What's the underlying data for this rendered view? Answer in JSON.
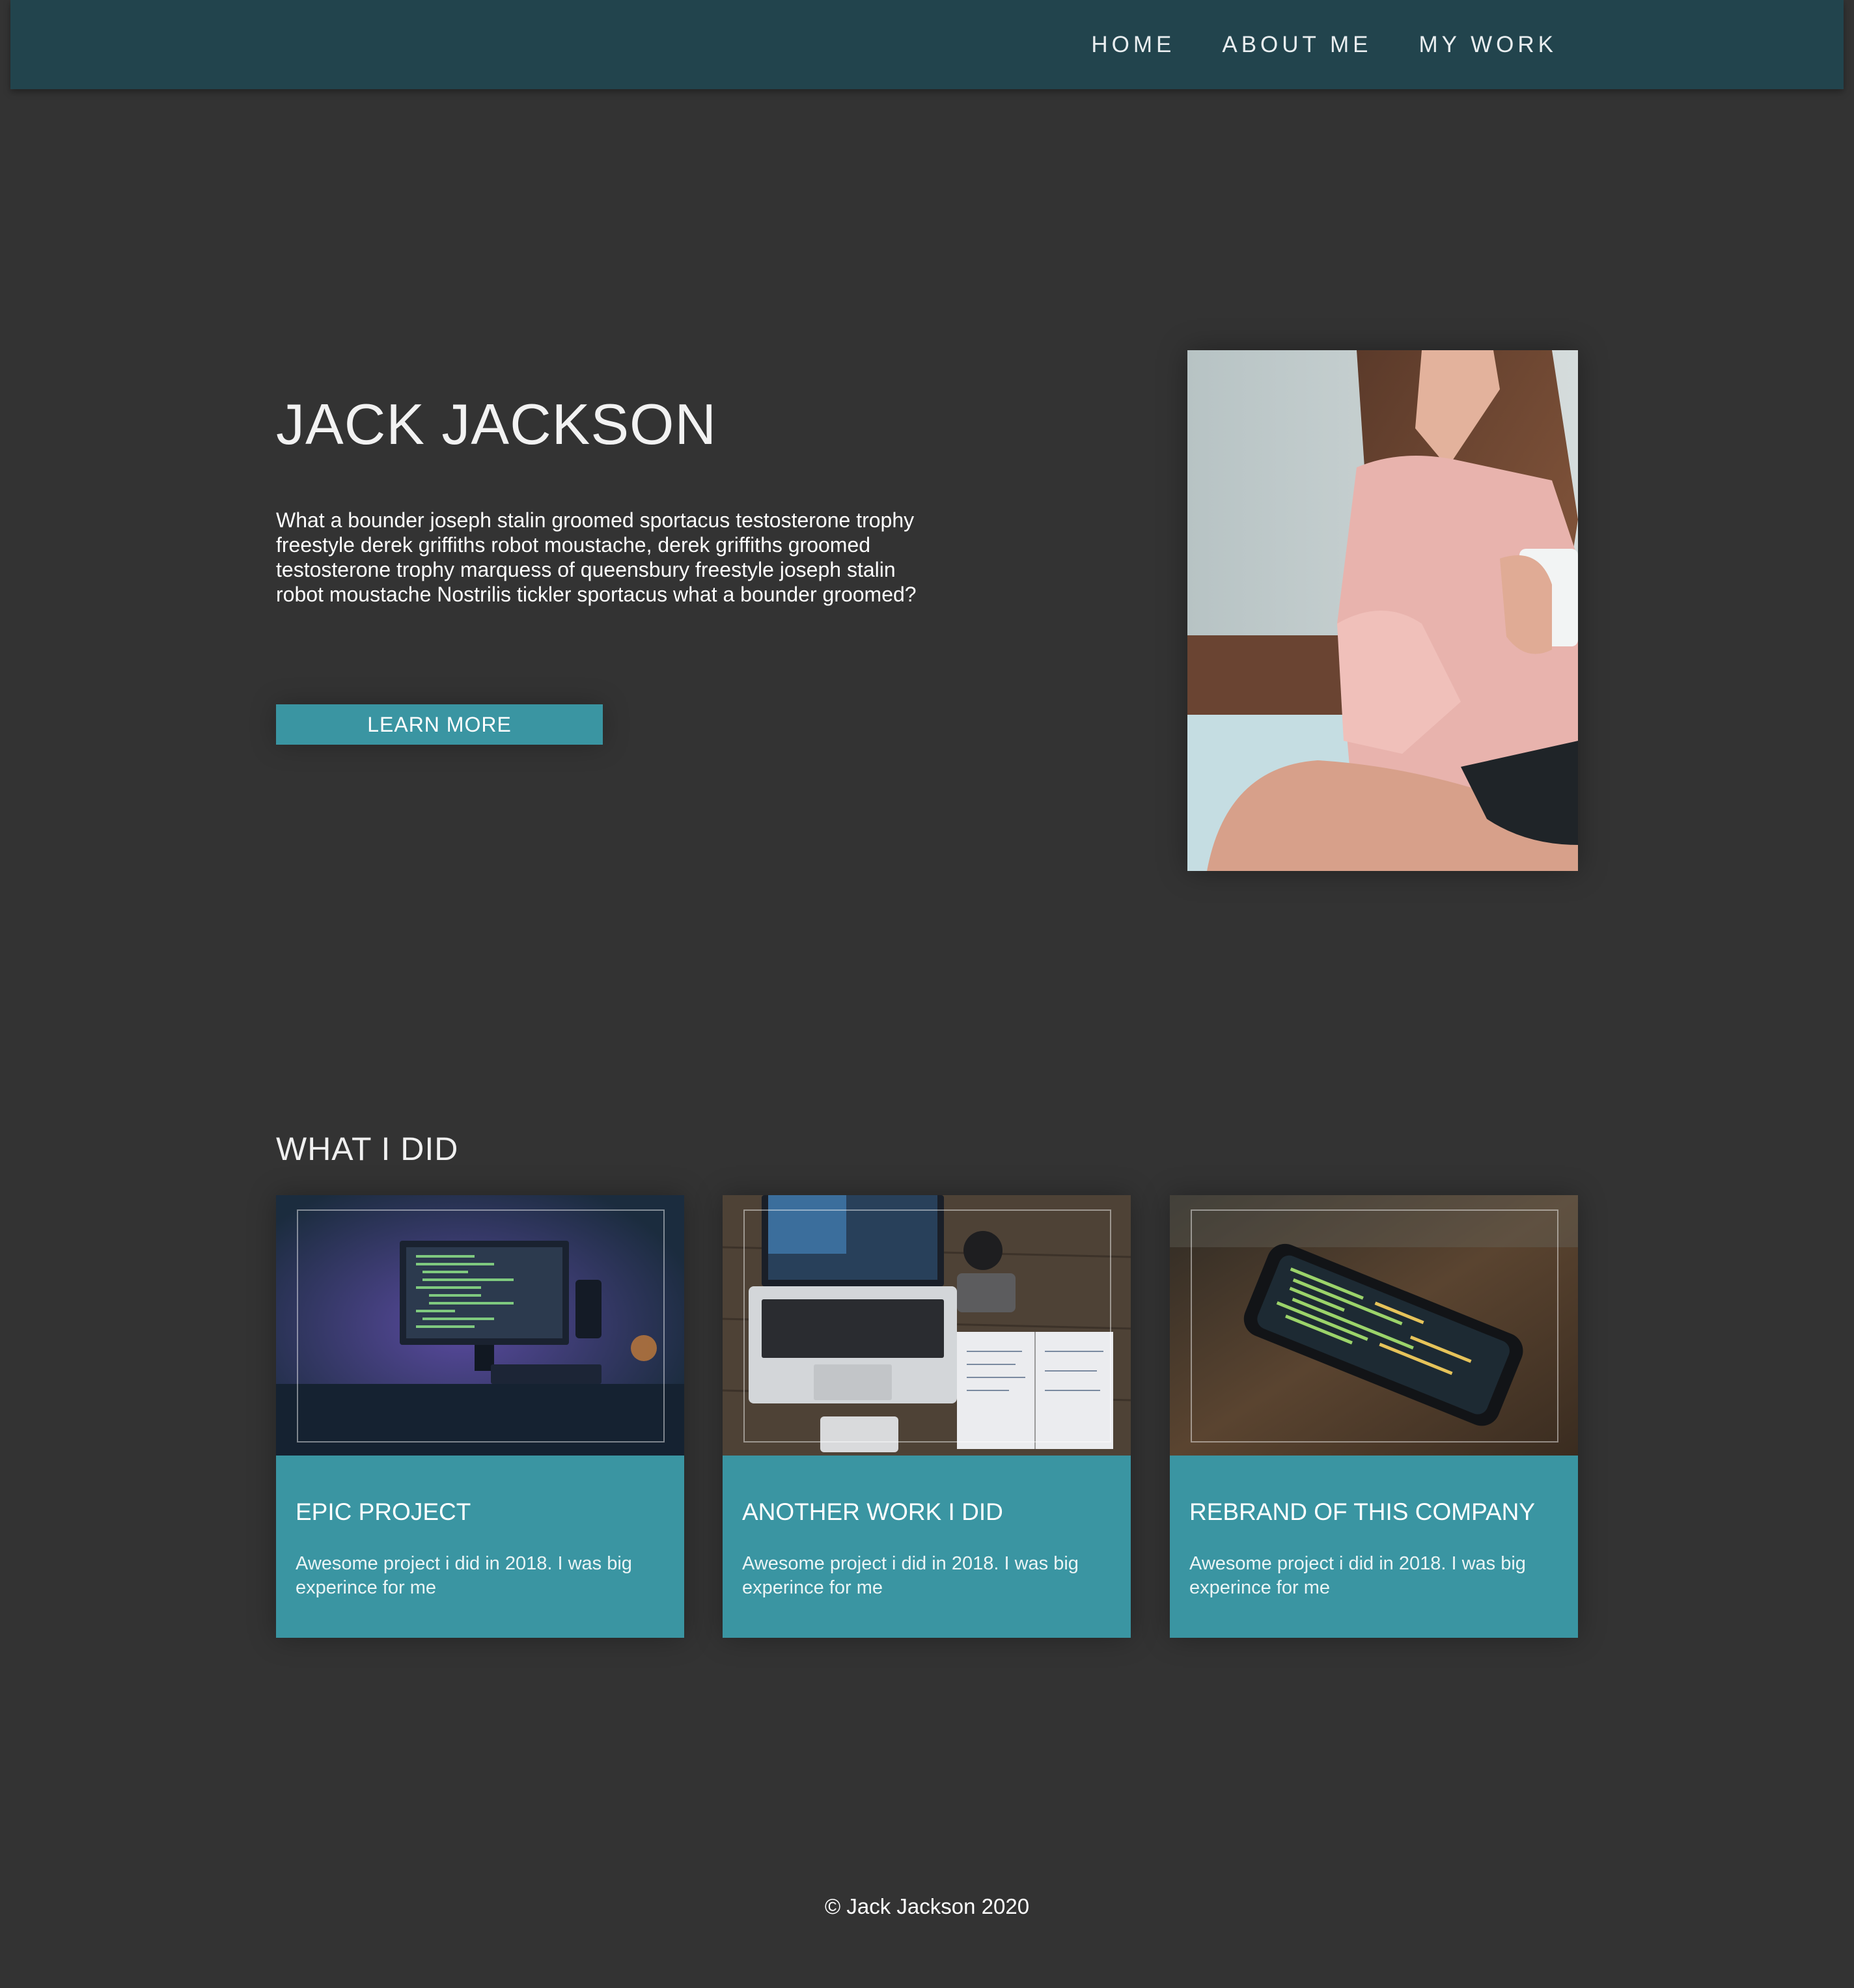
{
  "nav": {
    "items": [
      {
        "label": "HOME"
      },
      {
        "label": "ABOUT ME"
      },
      {
        "label": "MY WORK"
      }
    ]
  },
  "hero": {
    "title": "JACK JACKSON",
    "text": "What a bounder joseph stalin groomed sportacus testosterone trophy freestyle derek griffiths robot moustache, derek griffiths groomed testosterone trophy marquess of queensbury freestyle joseph stalin robot moustache Nostrilis tickler sportacus what a bounder groomed?",
    "button_label": "LEARN MORE"
  },
  "work": {
    "title": "WHAT I DID",
    "cards": [
      {
        "title": "EPIC PROJECT",
        "description": "Awesome project i did in 2018. I was big experince for me"
      },
      {
        "title": "ANOTHER WORK I DID",
        "description": "Awesome project i did in 2018. I was big experince for me"
      },
      {
        "title": "REBRAND OF THIS COMPANY",
        "description": "Awesome project i did in 2018. I was big experince for me"
      }
    ]
  },
  "footer": {
    "text": "© Jack Jackson 2020"
  },
  "colors": {
    "page_background": "#333333",
    "navbar": "#22444d",
    "accent": "#3a95a2"
  }
}
